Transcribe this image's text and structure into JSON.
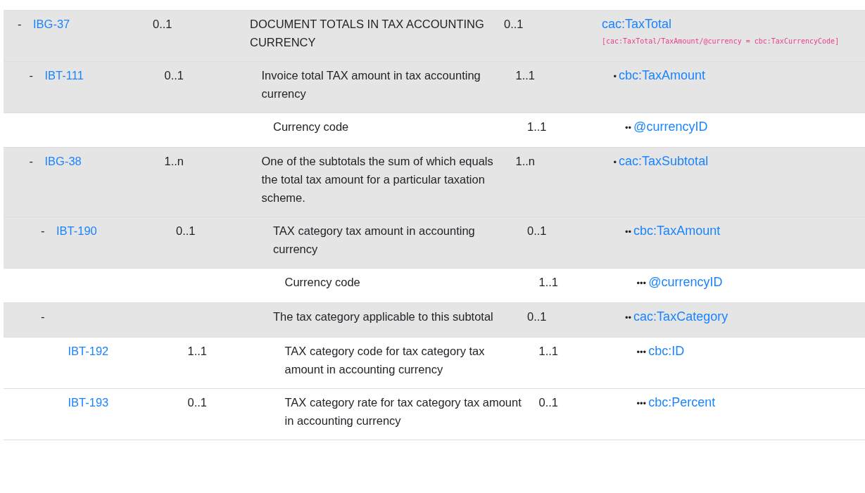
{
  "rows": [
    {
      "toggle": "-",
      "id": "IBG-37",
      "cardinality": "0..1",
      "description": "DOCUMENT TOTALS IN TAX ACCOUNTING CURRENCY",
      "syntax_cardinality": "0..1",
      "bullets": "",
      "path": "cac:TaxTotal",
      "rule": "[cac:TaxTotal/TaxAmount/@currency = cbc:TaxCurrencyCode]",
      "children": [
        {
          "toggle": "-",
          "id": "IBT-111",
          "cardinality": "0..1",
          "description": "Invoice total TAX amount in tax accounting currency",
          "syntax_cardinality": "1..1",
          "bullets": "•",
          "path": "cbc:TaxAmount",
          "children": [
            {
              "description": "Currency code",
              "syntax_cardinality": "1..1",
              "bullets": "••",
              "path": "@currencyID"
            }
          ]
        },
        {
          "toggle": "-",
          "id": "IBG-38",
          "cardinality": "1..n",
          "description": "One of the subtotals the sum of which equals the total tax amount for a particular taxation scheme.",
          "syntax_cardinality": "1..n",
          "bullets": "•",
          "path": "cac:TaxSubtotal",
          "children": [
            {
              "toggle": "-",
              "id": "IBT-190",
              "cardinality": "0..1",
              "description": "TAX category tax amount in accounting currency",
              "syntax_cardinality": "0..1",
              "bullets": "••",
              "path": "cbc:TaxAmount",
              "children": [
                {
                  "description": "Currency code",
                  "syntax_cardinality": "1..1",
                  "bullets": "•••",
                  "path": "@currencyID"
                }
              ]
            },
            {
              "toggle": "-",
              "description": "The tax category applicable to this subtotal",
              "syntax_cardinality": "0..1",
              "bullets": "••",
              "path": "cac:TaxCategory",
              "children": [
                {
                  "id": "IBT-192",
                  "cardinality": "1..1",
                  "description": "TAX category code for tax category tax amount in accounting currency",
                  "syntax_cardinality": "1..1",
                  "bullets": "•••",
                  "path": "cbc:ID"
                },
                {
                  "id": "IBT-193",
                  "cardinality": "0..1",
                  "description": "TAX category rate for tax category tax amount in accounting currency",
                  "syntax_cardinality": "0..1",
                  "bullets": "•••",
                  "path": "cbc:Percent"
                }
              ]
            }
          ]
        }
      ]
    }
  ]
}
